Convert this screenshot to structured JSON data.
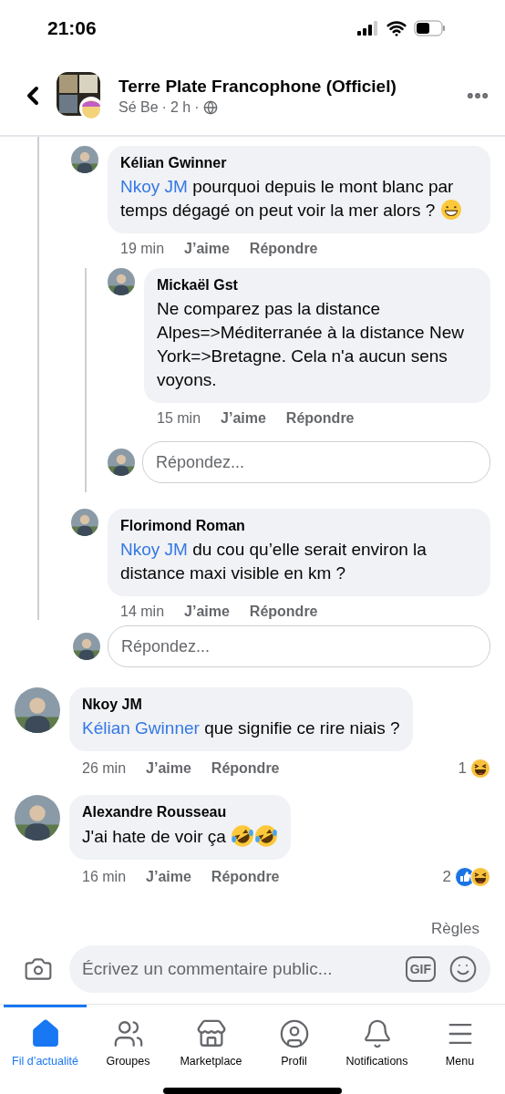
{
  "status_bar": {
    "time": "21:06"
  },
  "header": {
    "title": "Terre Plate Francophone (Officiel)",
    "author": "Sé Be",
    "separator": "·",
    "age": "2 h"
  },
  "thread": {
    "comments": [
      {
        "author": "Kélian Gwinner",
        "mention": "Nkoy JM",
        "text": "pourquoi depuis le mont blanc par temps dégagé on peut voir la mer alors ?",
        "emoji": [
          {
            "kind": "grin"
          }
        ],
        "time": "19 min",
        "like": "J’aime",
        "reply": "Répondre",
        "replies": [
          {
            "author": "Mickaël Gst",
            "text": "Ne comparez pas la distance Alpes=>Méditerranée à la distance New York=>Bretagne. Cela n'a aucun sens voyons.",
            "time": "15 min",
            "like": "J’aime",
            "reply": "Répondre"
          }
        ],
        "reply_field": {
          "placeholder": "Répondez..."
        }
      },
      {
        "author": "Florimond Roman",
        "mention": "Nkoy JM",
        "text": "du cou qu’elle serait environ la distance maxi visible en km ?",
        "time": "14 min",
        "like": "J’aime",
        "reply": "Répondre"
      }
    ],
    "reply_field": {
      "placeholder": "Répondez..."
    }
  },
  "comments": [
    {
      "author": "Nkoy JM",
      "mention": "Kélian Gwinner",
      "text": "que signifie ce rire niais ?",
      "time": "26 min",
      "like": "J’aime",
      "reply": "Répondre",
      "reactions": {
        "count": "1",
        "icons": [
          {
            "kind": "haha"
          }
        ]
      }
    },
    {
      "author": "Alexandre Rousseau",
      "text": "J'ai hate de voir ça",
      "emoji": [
        {
          "kind": "rofl"
        },
        {
          "kind": "rofl"
        }
      ],
      "time": "16 min",
      "like": "J’aime",
      "reply": "Répondre",
      "reactions": {
        "count": "2",
        "icons": [
          {
            "kind": "like"
          },
          {
            "kind": "haha"
          }
        ]
      }
    }
  ],
  "rules_link": "Règles",
  "composer": {
    "placeholder": "Écrivez un commentaire public..."
  },
  "gif_button": "GIF",
  "tabs": [
    {
      "kind": "home",
      "label": "Fil d’actualité",
      "selected": true
    },
    {
      "kind": "groups",
      "label": "Groupes",
      "selected": false
    },
    {
      "kind": "store",
      "label": "Marketplace",
      "selected": false
    },
    {
      "kind": "profile",
      "label": "Profil",
      "selected": false
    },
    {
      "kind": "bell",
      "label": "Notifications",
      "selected": false
    },
    {
      "kind": "menu",
      "label": "Menu",
      "selected": false
    }
  ]
}
